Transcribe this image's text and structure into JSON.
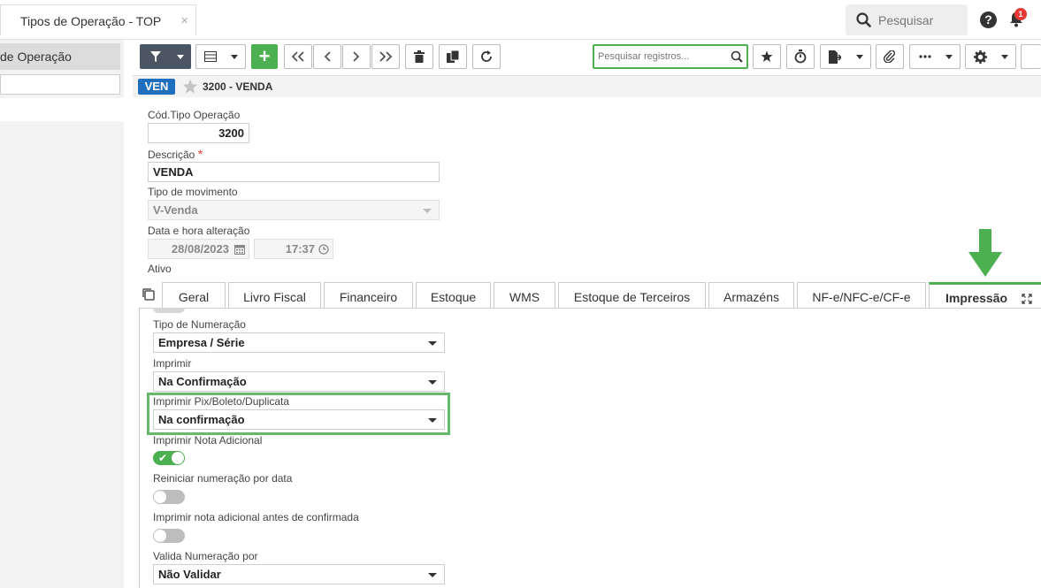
{
  "topbar": {
    "tab_title": "Tipos de Operação - TOP",
    "close_glyph": "×",
    "search_label": "Pesquisar",
    "help_glyph": "?",
    "notification_count": "1"
  },
  "left_panel": {
    "header": "de Operação"
  },
  "toolbar": {
    "search_placeholder": "Pesquisar registros...",
    "add_glyph": "+"
  },
  "record": {
    "badge": "VEN",
    "title": "3200 - VENDA"
  },
  "form": {
    "cod_label": "Cód.Tipo Operação",
    "cod_value": "3200",
    "descricao_label": "Descrição",
    "required_mark": "*",
    "descricao_value": "VENDA",
    "tipo_mov_label": "Tipo de movimento",
    "tipo_mov_value": "V-Venda",
    "data_label": "Data e hora alteração",
    "data_value": "28/08/2023",
    "hora_value": "17:37",
    "ativo_label": "Ativo"
  },
  "tabs": [
    {
      "label": "Geral"
    },
    {
      "label": "Livro Fiscal"
    },
    {
      "label": "Financeiro"
    },
    {
      "label": "Estoque"
    },
    {
      "label": "WMS"
    },
    {
      "label": "Estoque de Terceiros"
    },
    {
      "label": "Armazéns"
    },
    {
      "label": "NF-e/NFC-e/CF-e"
    },
    {
      "label": "Impressão"
    }
  ],
  "impressao": {
    "tipo_numeracao_label": "Tipo de Numeração",
    "tipo_numeracao_value": "Empresa / Série",
    "imprimir_label": "Imprimir",
    "imprimir_value": "Na Confirmação",
    "pix_label": "Imprimir Pix/Boleto/Duplicata",
    "pix_value": "Na confirmação",
    "nota_adicional_label": "Imprimir Nota Adicional",
    "nota_adicional_on": true,
    "reiniciar_label": "Reiniciar numeração por data",
    "reiniciar_on": false,
    "antes_confirmada_label": "Imprimir nota adicional antes de confirmada",
    "antes_confirmada_on": false,
    "valida_label": "Valida Numeração por",
    "valida_value": "Não Validar"
  },
  "colors": {
    "accent_green": "#4caf50",
    "badge_blue": "#1f6fbf",
    "toolbar_dark": "#4b5563",
    "notification_red": "#e53935"
  }
}
